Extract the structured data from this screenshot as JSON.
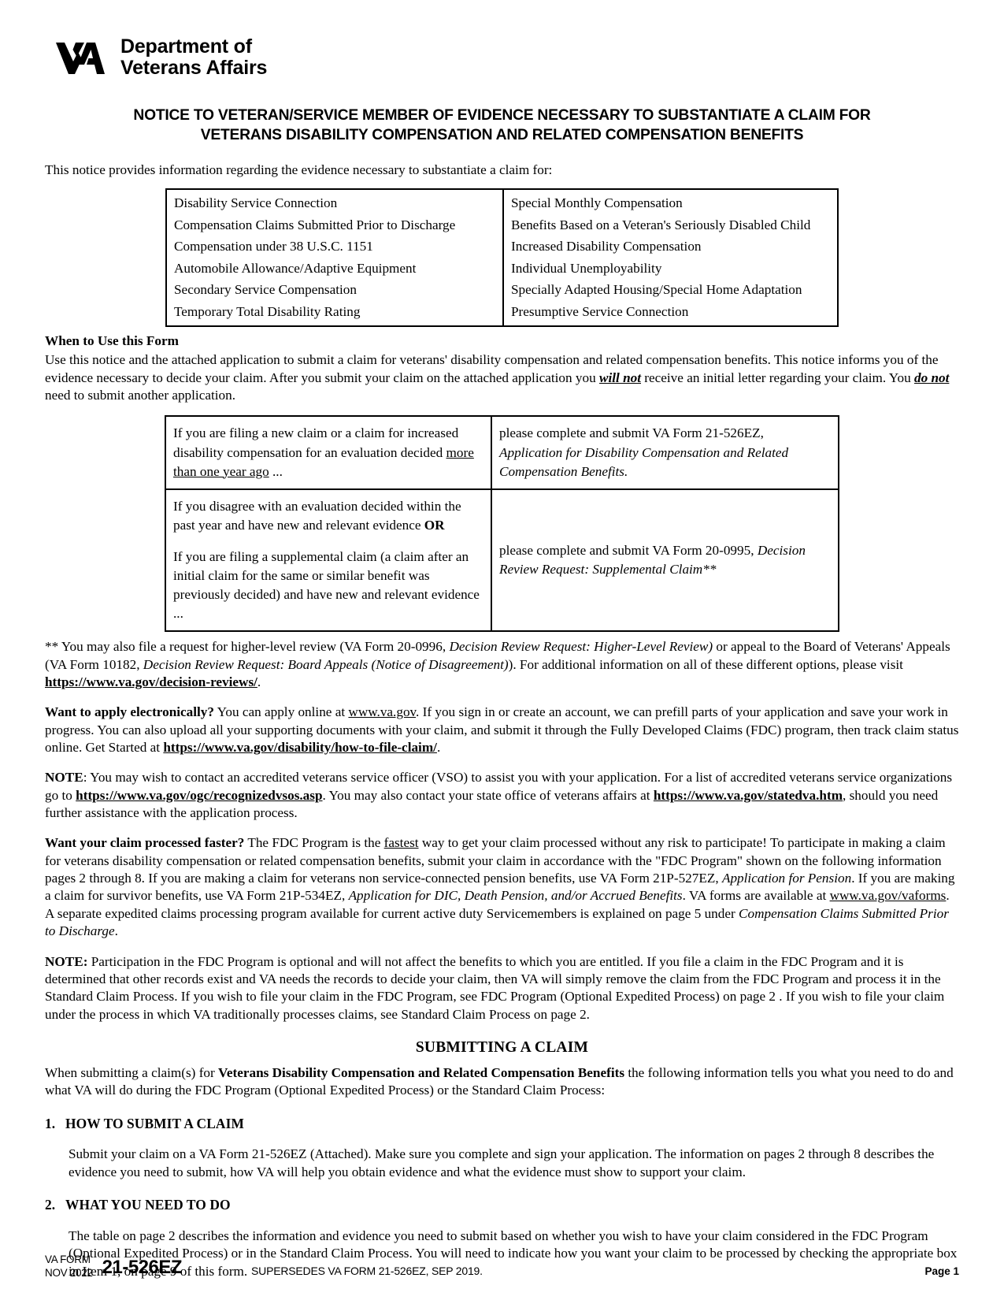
{
  "header": {
    "agency_line1": "Department of",
    "agency_line2": "Veterans Affairs",
    "logo_icon": "va-logo-icon"
  },
  "title": {
    "line1": "NOTICE TO VETERAN/SERVICE MEMBER OF EVIDENCE NECESSARY TO SUBSTANTIATE A CLAIM FOR",
    "line2": "VETERANS DISABILITY COMPENSATION AND RELATED COMPENSATION BENEFITS"
  },
  "intro": {
    "text": "This notice provides information regarding the evidence necessary to substantiate a claim for:"
  },
  "claim_types": {
    "left_column": [
      "Disability Service Connection",
      "Compensation Claims Submitted Prior to Discharge",
      "Compensation under 38 U.S.C. 1151",
      "Automobile Allowance/Adaptive Equipment",
      "Secondary Service Compensation",
      "Temporary Total Disability Rating"
    ],
    "right_column": [
      "Special Monthly Compensation",
      "Benefits Based on a Veteran's Seriously Disabled Child",
      "Increased Disability Compensation",
      "Individual Unemployability",
      "Specially Adapted Housing/Special Home Adaptation",
      "Presumptive Service Connection"
    ]
  },
  "when_to_use": {
    "heading": "When to Use this Form",
    "body_1": "Use this notice and the attached application to submit a claim for veterans' disability compensation and related compensation benefits. This notice informs you of the evidence necessary to decide your claim. After you submit your claim on the attached application you ",
    "emphasis_1": "will not",
    "body_2": " receive an initial letter regarding your claim. You ",
    "emphasis_2": "do not",
    "body_3": " need to submit another application."
  },
  "filing_table": {
    "row1": {
      "condition_part1": "If you are filing a new claim or a claim for increased disability compensation for an evaluation decided ",
      "condition_underlined": "more than one year ago",
      "condition_part2": " ...",
      "action_plain": "please complete and submit VA Form 21-526EZ, ",
      "action_italic": "Application for Disability Compensation and Related Compensation Benefits."
    },
    "row2": {
      "condition_a_part1": "If you disagree with an evaluation decided within the past year and have new and relevant evidence ",
      "condition_a_bold": "OR",
      "condition_b": "If you are filing a supplemental claim (a claim after an initial claim for the same or similar benefit was previously decided) and have new and relevant evidence ...",
      "action_plain": "please complete and submit VA Form 20-0995, ",
      "action_italic": "Decision Review Request: Supplemental Claim**"
    }
  },
  "footnote": {
    "part1": "** You may also file a request for higher-level review (VA Form 20-0996, ",
    "italic1": "Decision Review Request: Higher-Level Review)",
    "part2": " or appeal to the Board of Veterans' Appeals (VA Form 10182, ",
    "italic2": "Decision Review Request: Board Appeals (Notice of Disagreement)",
    "part3": "). For additional information on all of these different options, please visit ",
    "link": "https://www.va.gov/decision-reviews/",
    "part4": "."
  },
  "apply_electronically": {
    "lead": "Want to apply electronically?",
    "part1": " You can apply online at ",
    "link1": "www.va.gov",
    "part2": ". If you sign in or create an account, we can prefill parts of your application and save your work in progress. You can also upload all your supporting documents with your claim, and submit it through the Fully Developed Claims (FDC) program, then track claim status online. Get Started at ",
    "link2": "https://www.va.gov/disability/how-to-file-claim/",
    "part3": "."
  },
  "note_vso": {
    "lead": "NOTE",
    "part1": ": You may wish to contact an accredited veterans service officer (VSO) to assist you with your application.  For a list of accredited veterans service organizations go to ",
    "link1": "https://www.va.gov/ogc/recognizedvsos.asp",
    "part2": ". You may also contact your state office of veterans affairs at ",
    "link2": "https://www.va.gov/statedva.htm",
    "part3": ", should you need further assistance with the application process."
  },
  "faster": {
    "lead": "Want your claim processed faster?",
    "part1": " The FDC Program is the ",
    "underline1": "fastest",
    "part2": " way to get your claim processed without any risk to participate!  To participate in making a claim for veterans disability compensation or related compensation benefits, submit your claim in accordance with the \"FDC Program\" shown on the following information pages 2 through 8.  If you are making a claim for veterans non service-connected pension benefits, use VA Form 21P-527EZ, ",
    "italic1": "Application for Pension",
    "part3": ".  If you are making a claim for survivor benefits, use VA Form 21P-534EZ, ",
    "italic2": "Application for DIC, Death Pension, and/or Accrued Benefits",
    "part4": ".  VA forms are available at ",
    "link1": "www.va.gov/vaforms",
    "part5": ". A separate expedited claims processing program available for current active duty Servicemembers is explained on page 5 under ",
    "italic3": "Compensation Claims Submitted Prior to Discharge",
    "part6": "."
  },
  "note_fdc": {
    "lead": "NOTE:",
    "text": " Participation in the FDC Program is optional and will not affect the benefits to which you are entitled. If you file a claim in the FDC Program and it is determined that other records exist and VA needs the records to decide your claim, then VA will simply remove the claim from the FDC Program and process it in the Standard Claim Process. If you wish to file your claim in the FDC Program, see FDC Program (Optional Expedited Process) on page 2 . If you wish to file your claim under the process in which VA traditionally processes claims, see Standard Claim Process on page 2."
  },
  "submitting": {
    "heading": "SUBMITTING A CLAIM",
    "part1": "When submitting a claim(s) for ",
    "bold1": "Veterans Disability Compensation and Related Compensation Benefits",
    "part2": " the following information tells you what you need to do and what VA will do during the FDC Program (Optional Expedited Process) or the Standard Claim Process:"
  },
  "item_1": {
    "number": "1.",
    "heading": "HOW TO SUBMIT A CLAIM",
    "body": "Submit your claim on a VA Form 21-526EZ (Attached). Make sure you complete and sign your application.  The information on pages 2 through 8 describes the evidence you need to submit, how VA will help you obtain evidence and what the evidence must show to support your claim."
  },
  "item_2": {
    "number": "2.",
    "heading": "WHAT YOU NEED TO DO",
    "body": "The table on page 2 describes the information and evidence you need to submit based on whether you wish to have your claim considered in the FDC Program (Optional Expedited Process) or in the Standard Claim Process. You will need to indicate how you want your claim to be processed by checking the appropriate box in Item 1, on page 9 of this form."
  },
  "footer": {
    "form_label_line1": "VA FORM",
    "form_label_line2": "NOV 2022",
    "form_number": "21-526EZ",
    "supersedes": "SUPERSEDES VA FORM 21-526EZ, SEP 2019.",
    "page": "Page 1"
  }
}
